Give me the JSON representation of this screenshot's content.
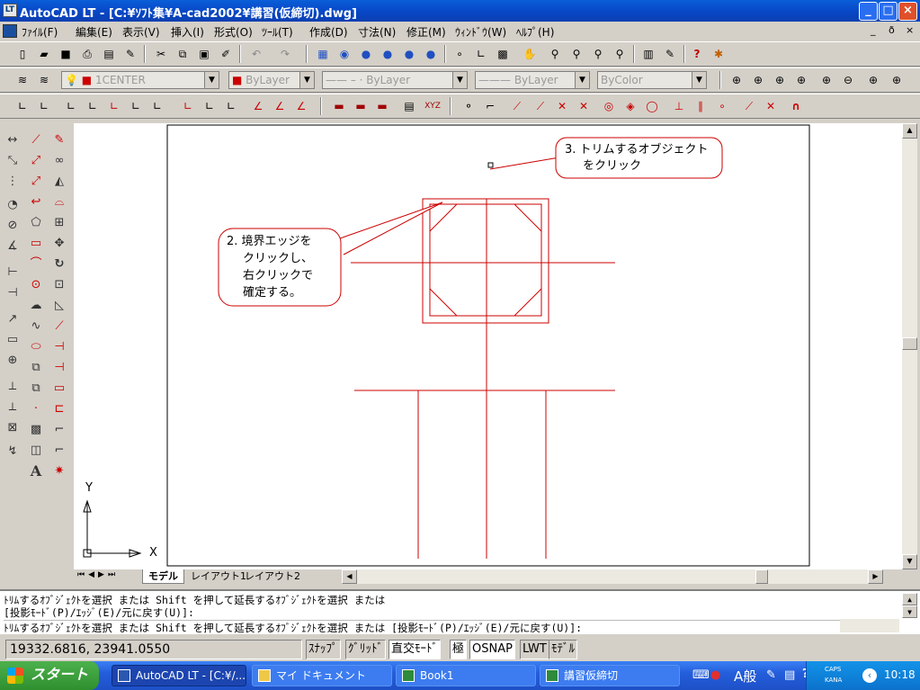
{
  "window": {
    "title": "AutoCAD LT - [C:¥ｿﾌﾄ集¥A-cad2002¥講習(仮締切).dwg]",
    "app_icon": "LT",
    "buttons": [
      "_",
      "□",
      "×"
    ]
  },
  "menubar": {
    "items": [
      "ﾌｧｲﾙ(F)",
      "編集(E)",
      "表示(V)",
      "挿入(I)",
      "形式(O)",
      "ﾂｰﾙ(T)",
      "作成(D)",
      "寸法(N)",
      "修正(M)",
      "ｳｨﾝﾄﾞｳ(W)",
      "ﾍﾙﾌﾟ(H)"
    ],
    "mdi": [
      "_",
      "ð",
      "×"
    ]
  },
  "layers_toolbar": {
    "layer": "1CENTER",
    "color": "ByLayer",
    "linetype": "ByLayer",
    "lineweight": "ByLayer",
    "plotstyle": "ByColor"
  },
  "drawing": {
    "callout2": {
      "line1": "2. 境界エッジを",
      "line2": "クリックし、",
      "line3": "右クリックで",
      "line4": "確定する。"
    },
    "callout3": {
      "line1": "3. トリムするオブジェクト",
      "line2": "をクリック"
    },
    "ucs": {
      "y": "Y",
      "x": "X"
    },
    "line_color": "#cc0000"
  },
  "tabs": [
    "モデル",
    "レイアウト1",
    "レイアウト2"
  ],
  "command": {
    "lines": [
      "ﾄﾘﾑするｵﾌﾞｼﾞｪｸﾄを選択 または Shift を押して延長するｵﾌﾞｼﾞｪｸﾄを選択 または",
      "[投影ﾓｰﾄﾞ(P)/ｴｯｼﾞ(E)/元に戻す(U)]:",
      "ﾄﾘﾑするｵﾌﾞｼﾞｪｸﾄを選択 または Shift を押して延長するｵﾌﾞｼﾞｪｸﾄを選択 または [投影ﾓｰﾄﾞ(P)/ｴｯｼﾞ(E)/元に戻す(U)]:"
    ]
  },
  "status": {
    "coords": "19332.6816, 23941.0550",
    "snap": "ｽﾅｯﾌﾟ",
    "grid": "ｸﾞﾘｯﾄﾞ",
    "ortho": "直交ﾓｰﾄﾞ",
    "polar": "極",
    "osnap": "OSNAP",
    "lwt": "LWT",
    "model": "ﾓﾃﾞﾙ"
  },
  "taskbar": {
    "start": "スタート",
    "tasks": [
      "AutoCAD LT - [C:¥/...",
      "マイ ドキュメント",
      "Book1",
      "講習仮締切"
    ],
    "ime": "A般",
    "caps": "CAPS",
    "kana": "KANA",
    "clock": "10:18"
  }
}
